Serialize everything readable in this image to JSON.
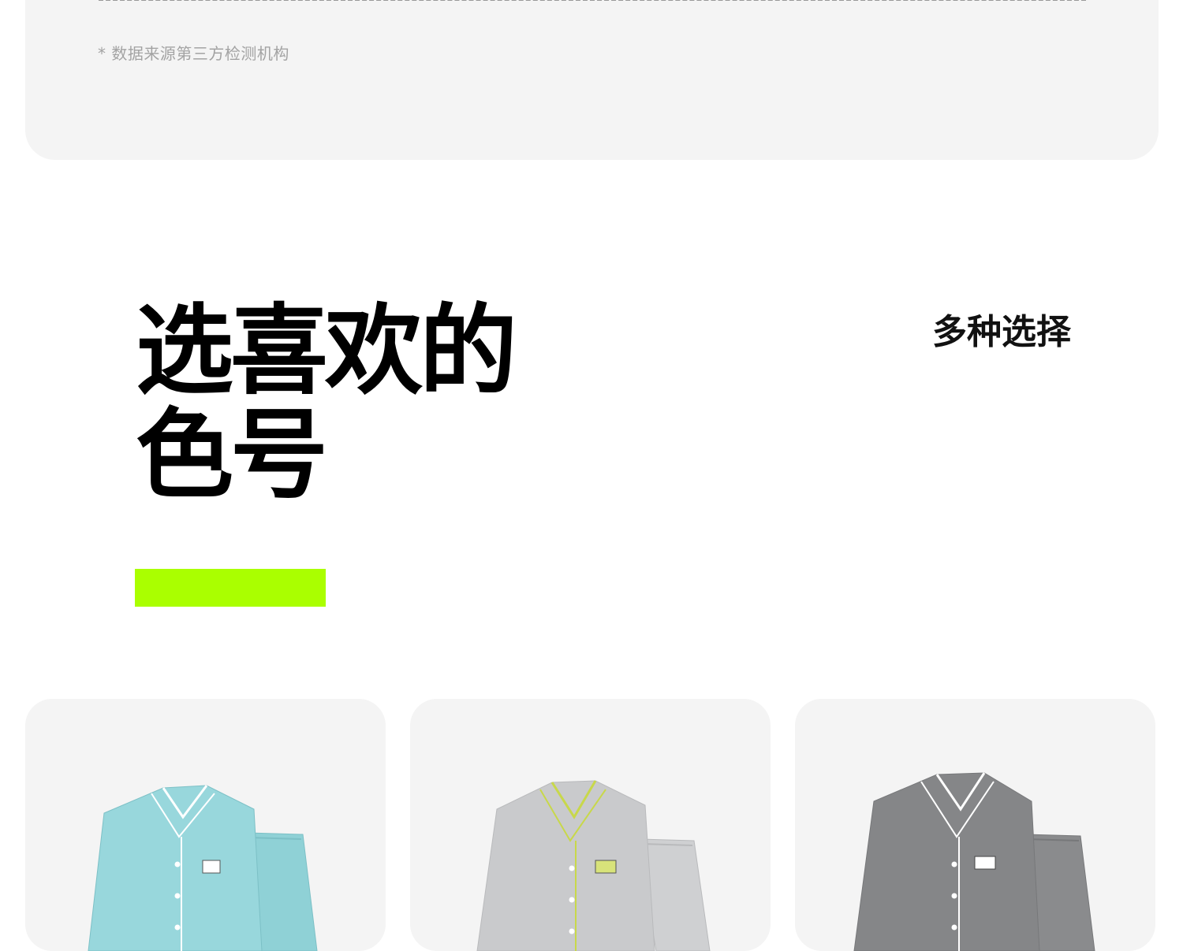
{
  "top_section": {
    "footnote": "* 数据来源第三方检测机构"
  },
  "title": {
    "line1": "选喜欢的",
    "line2": "色号"
  },
  "subtitle": "多种选择",
  "colors": {
    "accent": "#aaff00"
  },
  "products": [
    {
      "color_name": "light-blue",
      "hex": "#8fd1d6"
    },
    {
      "color_name": "light-grey",
      "hex": "#c9cacc"
    },
    {
      "color_name": "dark-grey",
      "hex": "#868789"
    }
  ]
}
